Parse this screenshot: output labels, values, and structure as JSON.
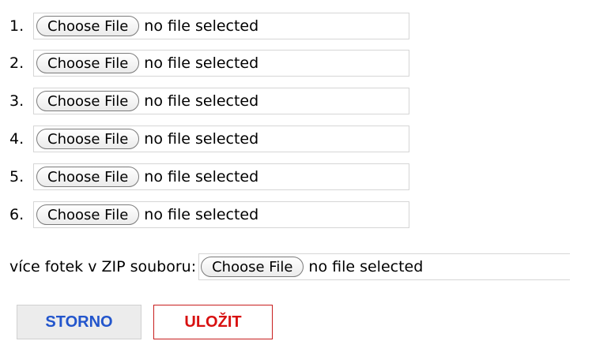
{
  "file_inputs": [
    {
      "number": "1.",
      "button_label": "Choose File",
      "status": "no file selected"
    },
    {
      "number": "2.",
      "button_label": "Choose File",
      "status": "no file selected"
    },
    {
      "number": "3.",
      "button_label": "Choose File",
      "status": "no file selected"
    },
    {
      "number": "4.",
      "button_label": "Choose File",
      "status": "no file selected"
    },
    {
      "number": "5.",
      "button_label": "Choose File",
      "status": "no file selected"
    },
    {
      "number": "6.",
      "button_label": "Choose File",
      "status": "no file selected"
    }
  ],
  "zip_upload": {
    "label": "více fotek v ZIP souboru:",
    "button_label": "Choose File",
    "status": "no file selected"
  },
  "actions": {
    "cancel_label": "STORNO",
    "save_label": "ULOŽIT"
  },
  "colors": {
    "cancel_text": "#2255cc",
    "save_text": "#d81010",
    "save_border": "#c81e1e"
  }
}
